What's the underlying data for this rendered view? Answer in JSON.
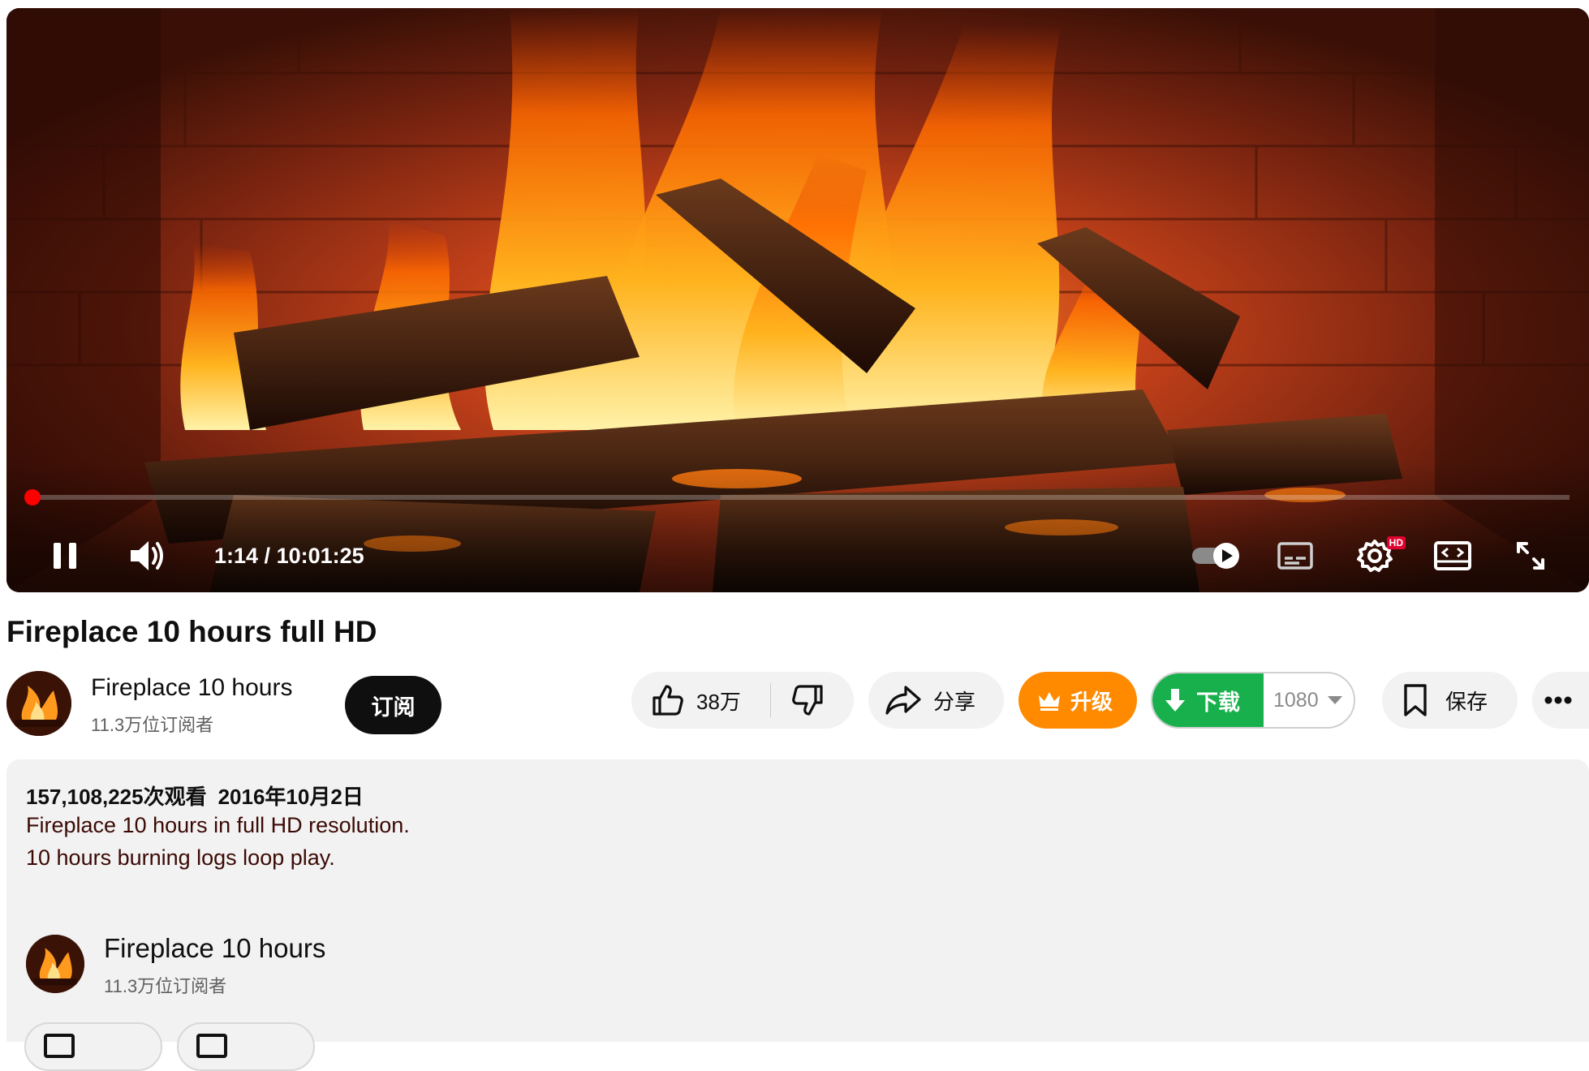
{
  "player": {
    "current_time": "1:14",
    "separator": " / ",
    "duration": "10:01:25",
    "progress_fraction": 0.0021,
    "settings_badge": "HD",
    "accent_color": "#ff0000"
  },
  "video": {
    "title": "Fireplace 10 hours full HD"
  },
  "channel": {
    "name": "Fireplace 10 hours",
    "subscribers": "11.3万位订阅者",
    "subscribe_label": "订阅"
  },
  "actions": {
    "like_count": "38万",
    "share_label": "分享",
    "upgrade_label": "升级",
    "download_label": "下载",
    "quality_value": "1080",
    "save_label": "保存",
    "upgrade_color": "#ff8a00",
    "download_color": "#18b04c"
  },
  "description": {
    "views": "157,108,225次观看",
    "date": "2016年10月2日",
    "lines": [
      "Fireplace 10 hours in full HD resolution.",
      "10 hours burning logs loop play."
    ],
    "channel_name": "Fireplace 10 hours",
    "channel_subscribers": "11.3万位订阅者"
  },
  "icons": {
    "pause": "pause-icon",
    "volume": "volume-icon",
    "autoplay": "autoplay-toggle-icon",
    "subtitles": "subtitles-icon",
    "settings": "gear-icon",
    "miniplayer": "miniplayer-icon",
    "fullscreen": "fullscreen-icon",
    "like": "thumbs-up-icon",
    "dislike": "thumbs-down-icon",
    "share": "share-arrow-icon",
    "upgrade": "crown-icon",
    "download": "download-arrow-icon",
    "save": "bookmark-icon",
    "more": "more-horizontal-icon"
  }
}
